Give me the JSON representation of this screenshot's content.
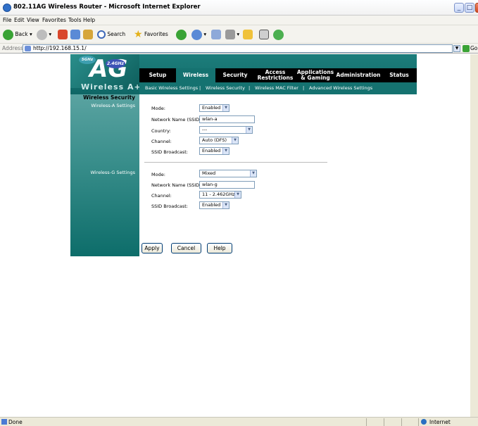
{
  "window": {
    "title": "802.11AG Wireless Router - Microsoft Internet Explorer",
    "min": "_",
    "max": "□"
  },
  "menu": [
    "File",
    "Edit",
    "View",
    "Favorites",
    "Tools",
    "Help"
  ],
  "toolbar": {
    "back": "Back",
    "search": "Search",
    "favorites": "Favorites"
  },
  "address": {
    "label": "Address",
    "url": "http://192.168.15.1/",
    "go": "Go"
  },
  "brand": {
    "tag1": "5GHz",
    "tag2": "2.4GHz",
    "letter": "AG",
    "text": "Wireless A+G"
  },
  "nav": {
    "tabs": [
      "Setup",
      "Wireless",
      "Security",
      "Access Restrictions",
      "Applications & Gaming",
      "Administration",
      "Status"
    ],
    "active": "Wireless",
    "sub": [
      "Basic Wireless Settings",
      "|",
      "Wireless Security",
      "|",
      "Wireless MAC Filter",
      "|",
      "Advanced Wireless Settings"
    ]
  },
  "page_title": "Wireless Security",
  "wireless_a": {
    "section": "Wireless-A Settings",
    "mode_label": "Mode:",
    "mode": "Enabled",
    "ssid_label": "Network Name (SSID):",
    "ssid": "wlan-a",
    "country_label": "Country:",
    "country": "---",
    "channel_label": "Channel:",
    "channel": "Auto (DFS)",
    "broadcast_label": "SSID Broadcast:",
    "broadcast": "Enabled"
  },
  "wireless_g": {
    "section": "Wireless-G Settings",
    "mode_label": "Mode:",
    "mode": "Mixed",
    "ssid_label": "Network Name (SSID):",
    "ssid": "wlan-g",
    "channel_label": "Channel:",
    "channel": "11 - 2.462GHz",
    "broadcast_label": "SSID Broadcast:",
    "broadcast": "Enabled"
  },
  "buttons": {
    "apply": "Apply",
    "cancel": "Cancel",
    "help": "Help"
  },
  "status": {
    "text": "Done",
    "zone": "Internet"
  }
}
